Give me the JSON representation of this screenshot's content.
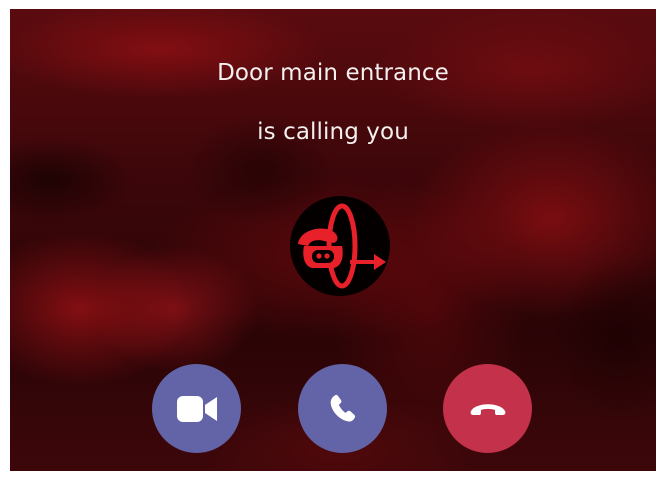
{
  "call": {
    "caller_line1": "Door main entrance",
    "caller_line2": "is calling you"
  },
  "avatar": {
    "icon": "intercom-handset-logo-icon"
  },
  "actions": [
    {
      "id": "video",
      "icon": "video-camera-icon",
      "color": "#6264a7"
    },
    {
      "id": "audio",
      "icon": "phone-icon",
      "color": "#6264a7"
    },
    {
      "id": "decline",
      "icon": "hang-up-icon",
      "color": "#c4314b"
    }
  ],
  "colors": {
    "background_red": "#5a0b0f",
    "logo_red": "#e8202a",
    "text": "#f4f0f0"
  }
}
